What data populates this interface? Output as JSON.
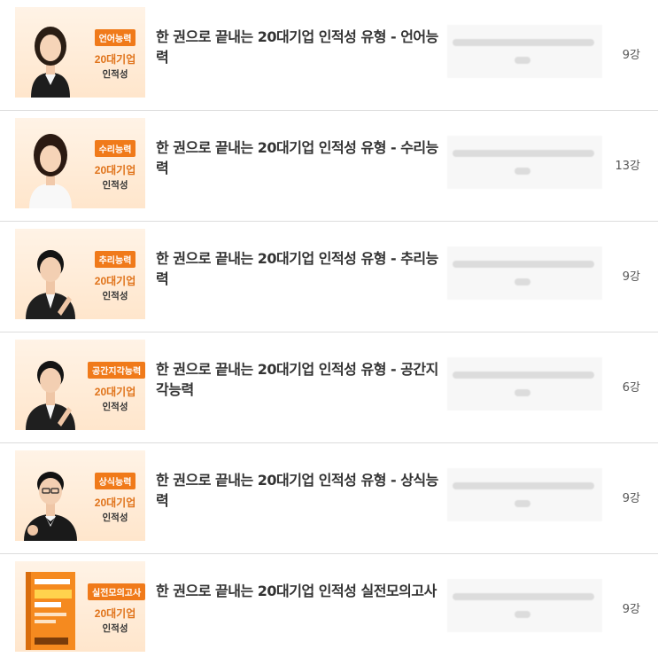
{
  "colors": {
    "accent": "#f07a1a",
    "thumb_bg": "#ffe9d4",
    "title_text": "#333333"
  },
  "courses": [
    {
      "tag": "언어능력",
      "line1": "20대기업",
      "line2": "인적성",
      "title": "한 권으로 끝내는 20대기업 인적성 유형 - 언어능력",
      "lessons": "9강",
      "image": "instructor-female-1"
    },
    {
      "tag": "수리능력",
      "line1": "20대기업",
      "line2": "인적성",
      "title": "한 권으로 끝내는 20대기업 인적성 유형 - 수리능력",
      "lessons": "13강",
      "image": "instructor-female-2"
    },
    {
      "tag": "추리능력",
      "line1": "20대기업",
      "line2": "인적성",
      "title": "한 권으로 끝내는 20대기업 인적성 유형 - 추리능력",
      "lessons": "9강",
      "image": "instructor-male-1"
    },
    {
      "tag": "공간지각능력",
      "line1": "20대기업",
      "line2": "인적성",
      "title": "한 권으로 끝내는 20대기업 인적성 유형 - 공간지각능력",
      "lessons": "6강",
      "image": "instructor-male-1"
    },
    {
      "tag": "상식능력",
      "line1": "20대기업",
      "line2": "인적성",
      "title": "한 권으로 끝내는 20대기업 인적성 유형 - 상식능력",
      "lessons": "9강",
      "image": "instructor-male-2"
    },
    {
      "tag": "실전모의고사",
      "line1": "20대기업",
      "line2": "인적성",
      "title": "한 권으로 끝내는 20대기업 인적성 실전모의고사",
      "lessons": "9강",
      "image": "book-cover"
    }
  ]
}
